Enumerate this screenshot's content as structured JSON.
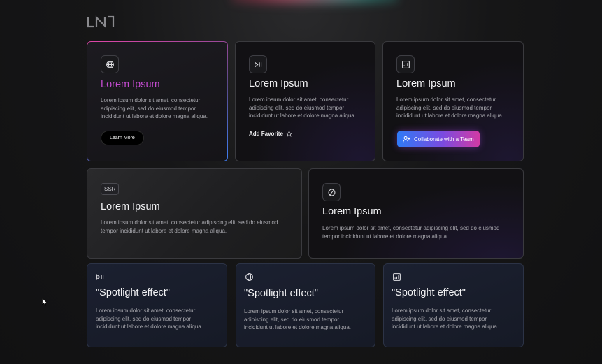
{
  "cards": [
    {
      "title": "Lorem Ipsum",
      "desc": "Lorem ipsum dolor sit amet, consectetur adipiscing elit, sed do eiusmod tempor incididunt ut labore et dolore magna aliqua.",
      "action": "Learn More",
      "icon": "globe-icon"
    },
    {
      "title": "Lorem Ipsum",
      "desc": "Lorem ipsum dolor sit amet, consectetur adipiscing elit, sed do eiusmod tempor incididunt ut labore et dolore magna aliqua.",
      "action": "Add Favorite",
      "icon": "play-pause-icon"
    },
    {
      "title": "Lorem Ipsum",
      "desc": "Lorem ipsum dolor sit amet, consectetur adipiscing elit, sed do eiusmod tempor incididunt ut labore et dolore magna aliqua.",
      "action": "Collaborate with a Team",
      "icon": "bar-chart-icon"
    },
    {
      "title": "Lorem Ipsum",
      "desc": "Lorem ipsum dolor sit amet, consectetur adipiscing elit, sed do eiusmod tempor incididunt ut labore et dolore magna aliqua.",
      "tag": "SSR"
    },
    {
      "title": "Lorem Ipsum",
      "desc": "Lorem ipsum dolor sit amet, consectetur adipiscing elit, sed do eiusmod tempor incididunt ut labore et dolore magna aliqua.",
      "icon": "slash-circle-icon"
    }
  ],
  "spotlight": [
    {
      "title": "\"Spotlight effect\"",
      "desc": "Lorem ipsum dolor sit amet, consectetur adipiscing elit, sed do eiusmod tempor incididunt ut labore et dolore magna aliqua.",
      "icon": "play-pause-icon"
    },
    {
      "title": "\"Spotlight effect\"",
      "desc": "Lorem ipsum dolor sit amet, consectetur adipiscing elit, sed do eiusmod tempor incididunt ut labore et dolore magna aliqua.",
      "icon": "globe-icon"
    },
    {
      "title": "\"Spotlight effect\"",
      "desc": "Lorem ipsum dolor sit amet, consectetur adipiscing elit, sed do eiusmod tempor incididunt ut labore et dolore magna aliqua.",
      "icon": "bar-chart-icon"
    }
  ],
  "colors": {
    "accent_pink": "#c44bd0",
    "accent_blue": "#2f7af6",
    "background": "#161617"
  }
}
